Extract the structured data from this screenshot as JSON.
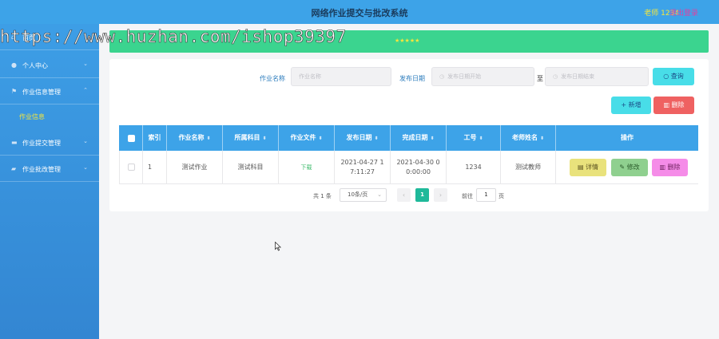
{
  "header": {
    "title": "网络作业提交与批改系统",
    "user": "老师 1234",
    "logout": "退出登录"
  },
  "watermark": "https://www.huzhan.com/ishop39397",
  "sidebar": {
    "items": [
      {
        "label": "首页",
        "icon": "home-icon"
      },
      {
        "label": "个人中心",
        "icon": "user-icon"
      },
      {
        "label": "作业信息管理",
        "icon": "flag-icon"
      },
      {
        "label": "作业提交管理",
        "icon": "folder-icon"
      },
      {
        "label": "作业批改管理",
        "icon": "box-icon"
      }
    ],
    "active_sub": "作业信息"
  },
  "banner": {
    "stars": "★★★★★"
  },
  "filters": {
    "name_label": "作业名称",
    "name_placeholder": "作业名称",
    "date_label": "发布日期",
    "date_start_placeholder": "发布日期开始",
    "to": "至",
    "date_end_placeholder": "发布日期结束",
    "search": "查询"
  },
  "actions": {
    "add": "新增",
    "delete": "删除"
  },
  "table": {
    "headers": [
      "索引",
      "作业名称",
      "所属科目",
      "作业文件",
      "发布日期",
      "完成日期",
      "工号",
      "老师姓名",
      "操作"
    ],
    "rows": [
      {
        "index": "1",
        "name": "测试作业",
        "subject": "测试科目",
        "file": "下载",
        "publish_date_1": "2021-04-27 1",
        "publish_date_2": "7:11:27",
        "finish_date_1": "2021-04-30 0",
        "finish_date_2": "0:00:00",
        "work_no": "1234",
        "teacher": "测试教师",
        "detail": "详情",
        "edit": "修改",
        "delete": "删除"
      }
    ]
  },
  "pagination": {
    "total": "共 1 条",
    "page_size": "10条/页",
    "current": "1",
    "goto": "前往",
    "jump_value": "1",
    "page_unit": "页"
  }
}
